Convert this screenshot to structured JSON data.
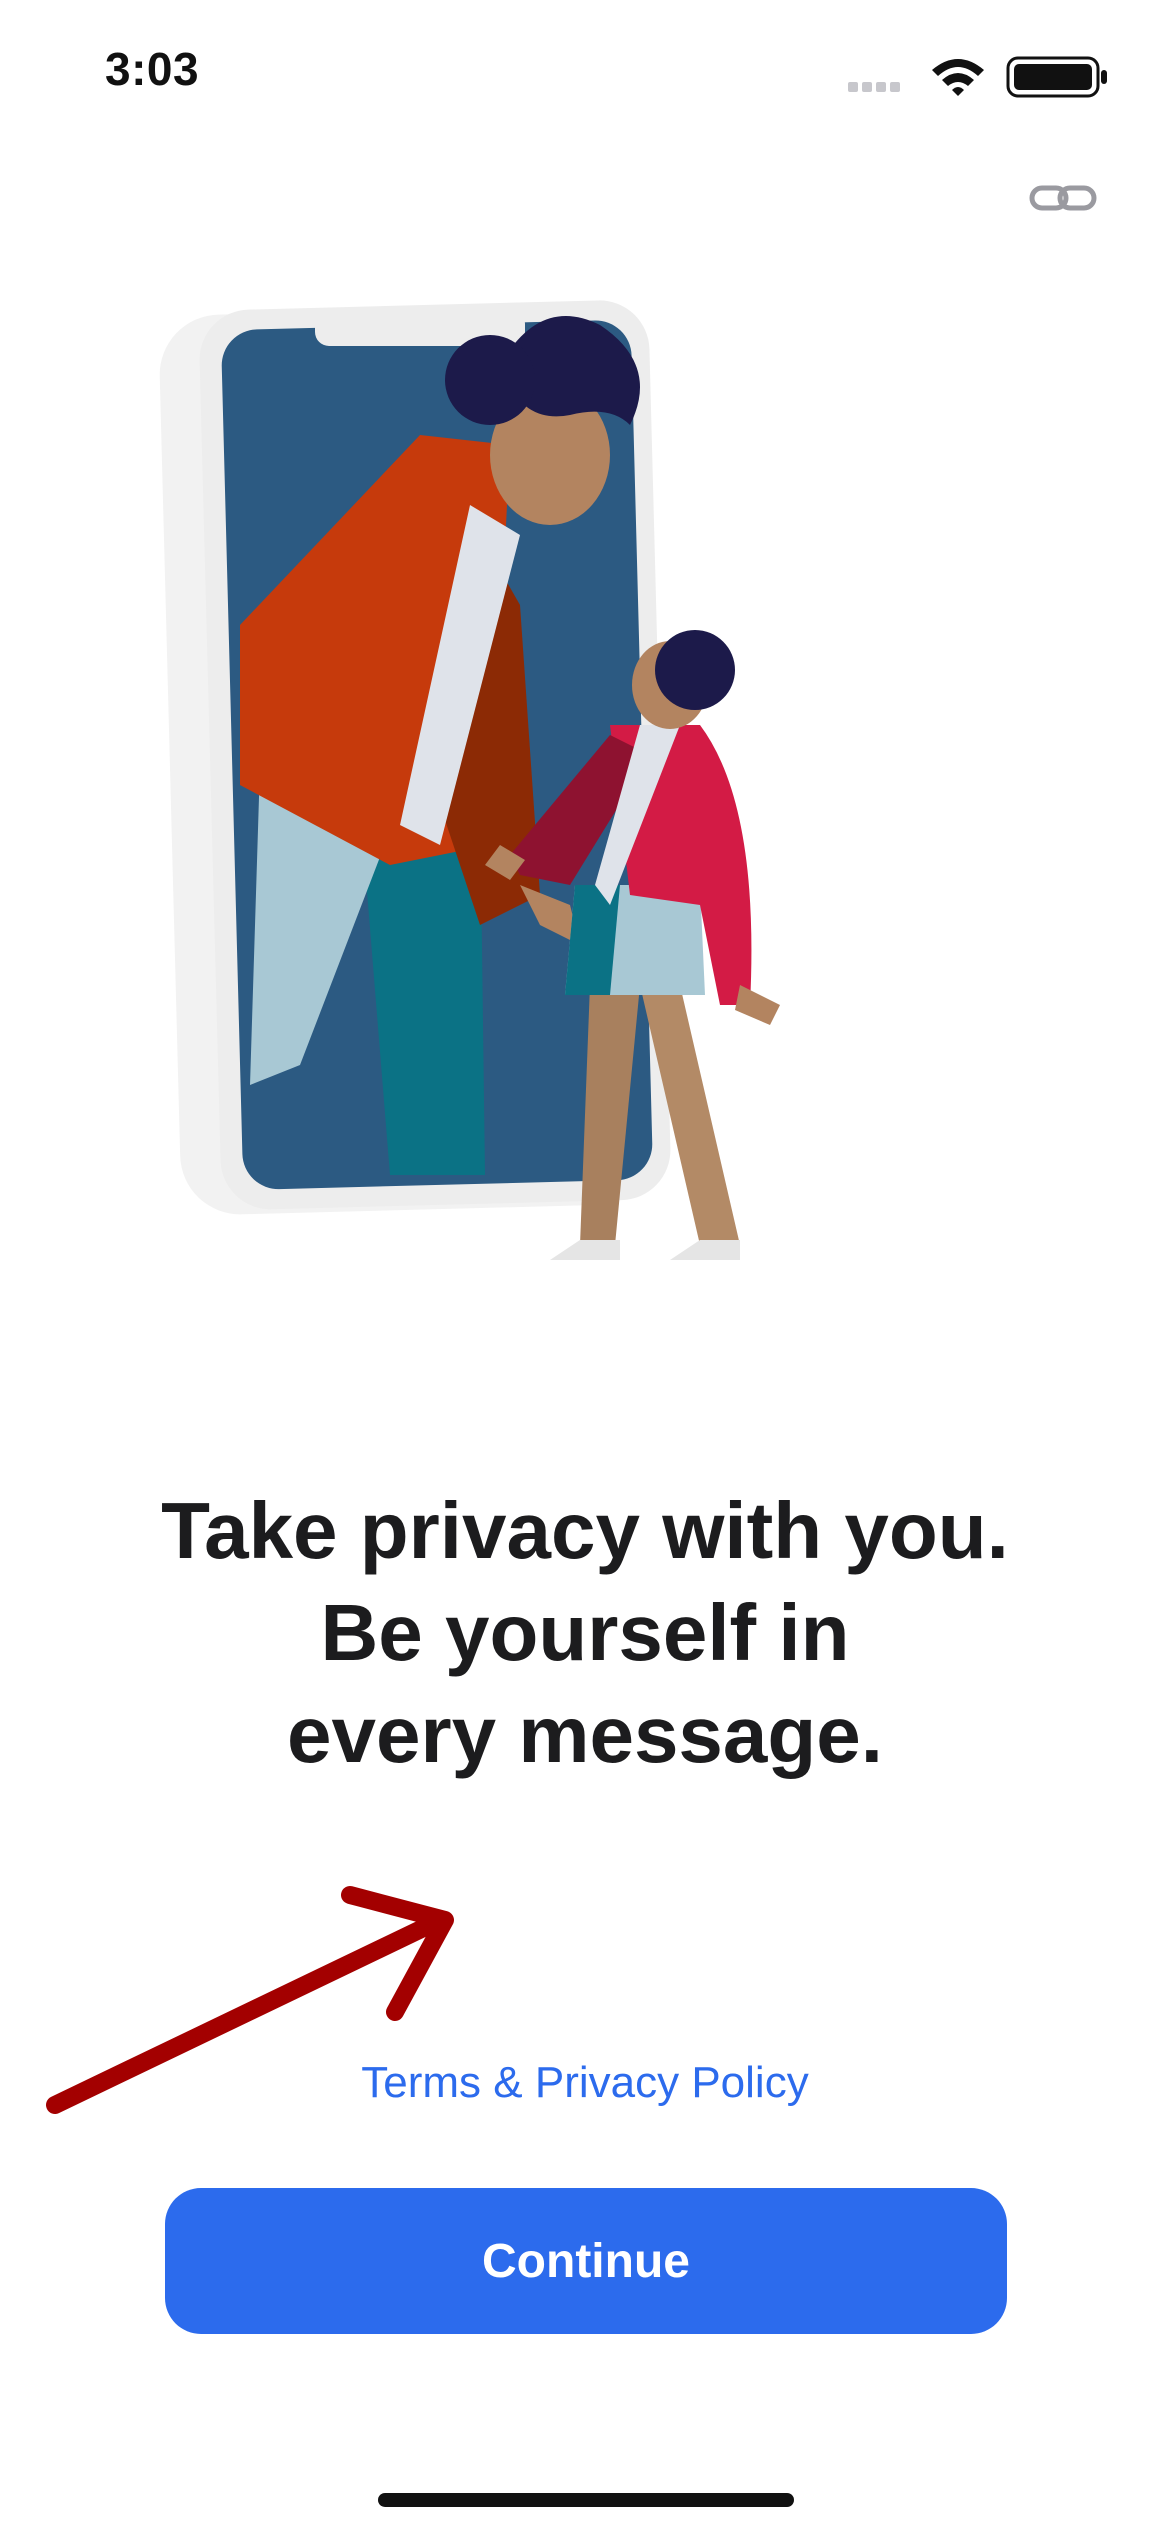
{
  "status_bar": {
    "time": "3:03",
    "icons": [
      "cellular-signal-icon",
      "wifi-icon",
      "battery-icon"
    ]
  },
  "toolbar": {
    "link_icon": "link-icon"
  },
  "illustration": {
    "name": "person-leaning-out-of-phone-illustration"
  },
  "headline": {
    "lines": [
      "Take privacy with you.",
      "Be yourself in",
      "every message."
    ]
  },
  "terms_link": "Terms & Privacy Policy",
  "continue_button": "Continue",
  "colors": {
    "accent": "#2c6bed",
    "text": "#1c1c1e",
    "annotation": "#a30000"
  }
}
